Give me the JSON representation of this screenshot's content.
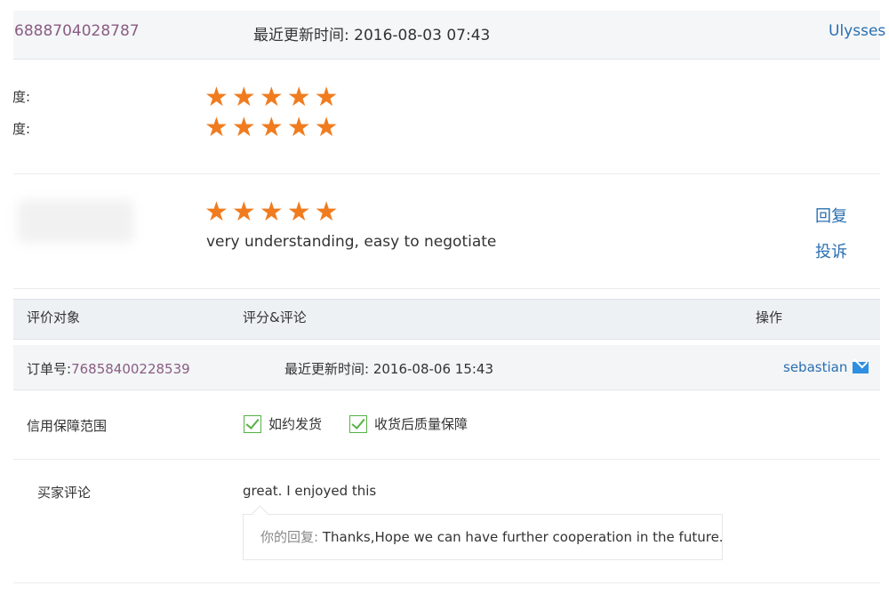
{
  "review1": {
    "order_id": "6888704028787",
    "updated_label": "最近更新时间:",
    "updated_value": "2016-08-03 07:43",
    "buyer": "Ulysses",
    "rating_label_1": "度:",
    "rating_label_2": "度:",
    "rating_1": 5,
    "rating_2": 5,
    "rating_3": 5,
    "comment": "very understanding, easy to negotiate",
    "reply_link": "回复",
    "complain_link": "投诉"
  },
  "table_header": {
    "col1": "评价对象",
    "col2": "评分&评论",
    "col3": "操作"
  },
  "review2": {
    "order_label": "订单号:",
    "order_id": "76858400228539",
    "updated_label": "最近更新时间:",
    "updated_value": "2016-08-06 15:43",
    "buyer": "sebastian",
    "guarantee_label": "信用保障范围",
    "guarantee_items": [
      "如约发货",
      "收货后质量保障"
    ],
    "buyer_comment_label": "买家评论",
    "buyer_comment": "great. I enjoyed this",
    "reply_prefix": "你的回复:",
    "reply_text": "Thanks,Hope we can have further cooperation in the future."
  },
  "colors": {
    "star": "#f07c1f",
    "link": "#2a6fb0",
    "order_id": "#8a5c82",
    "check": "#57b147"
  },
  "icons": [
    "star-icon",
    "check-icon",
    "mail-icon"
  ]
}
